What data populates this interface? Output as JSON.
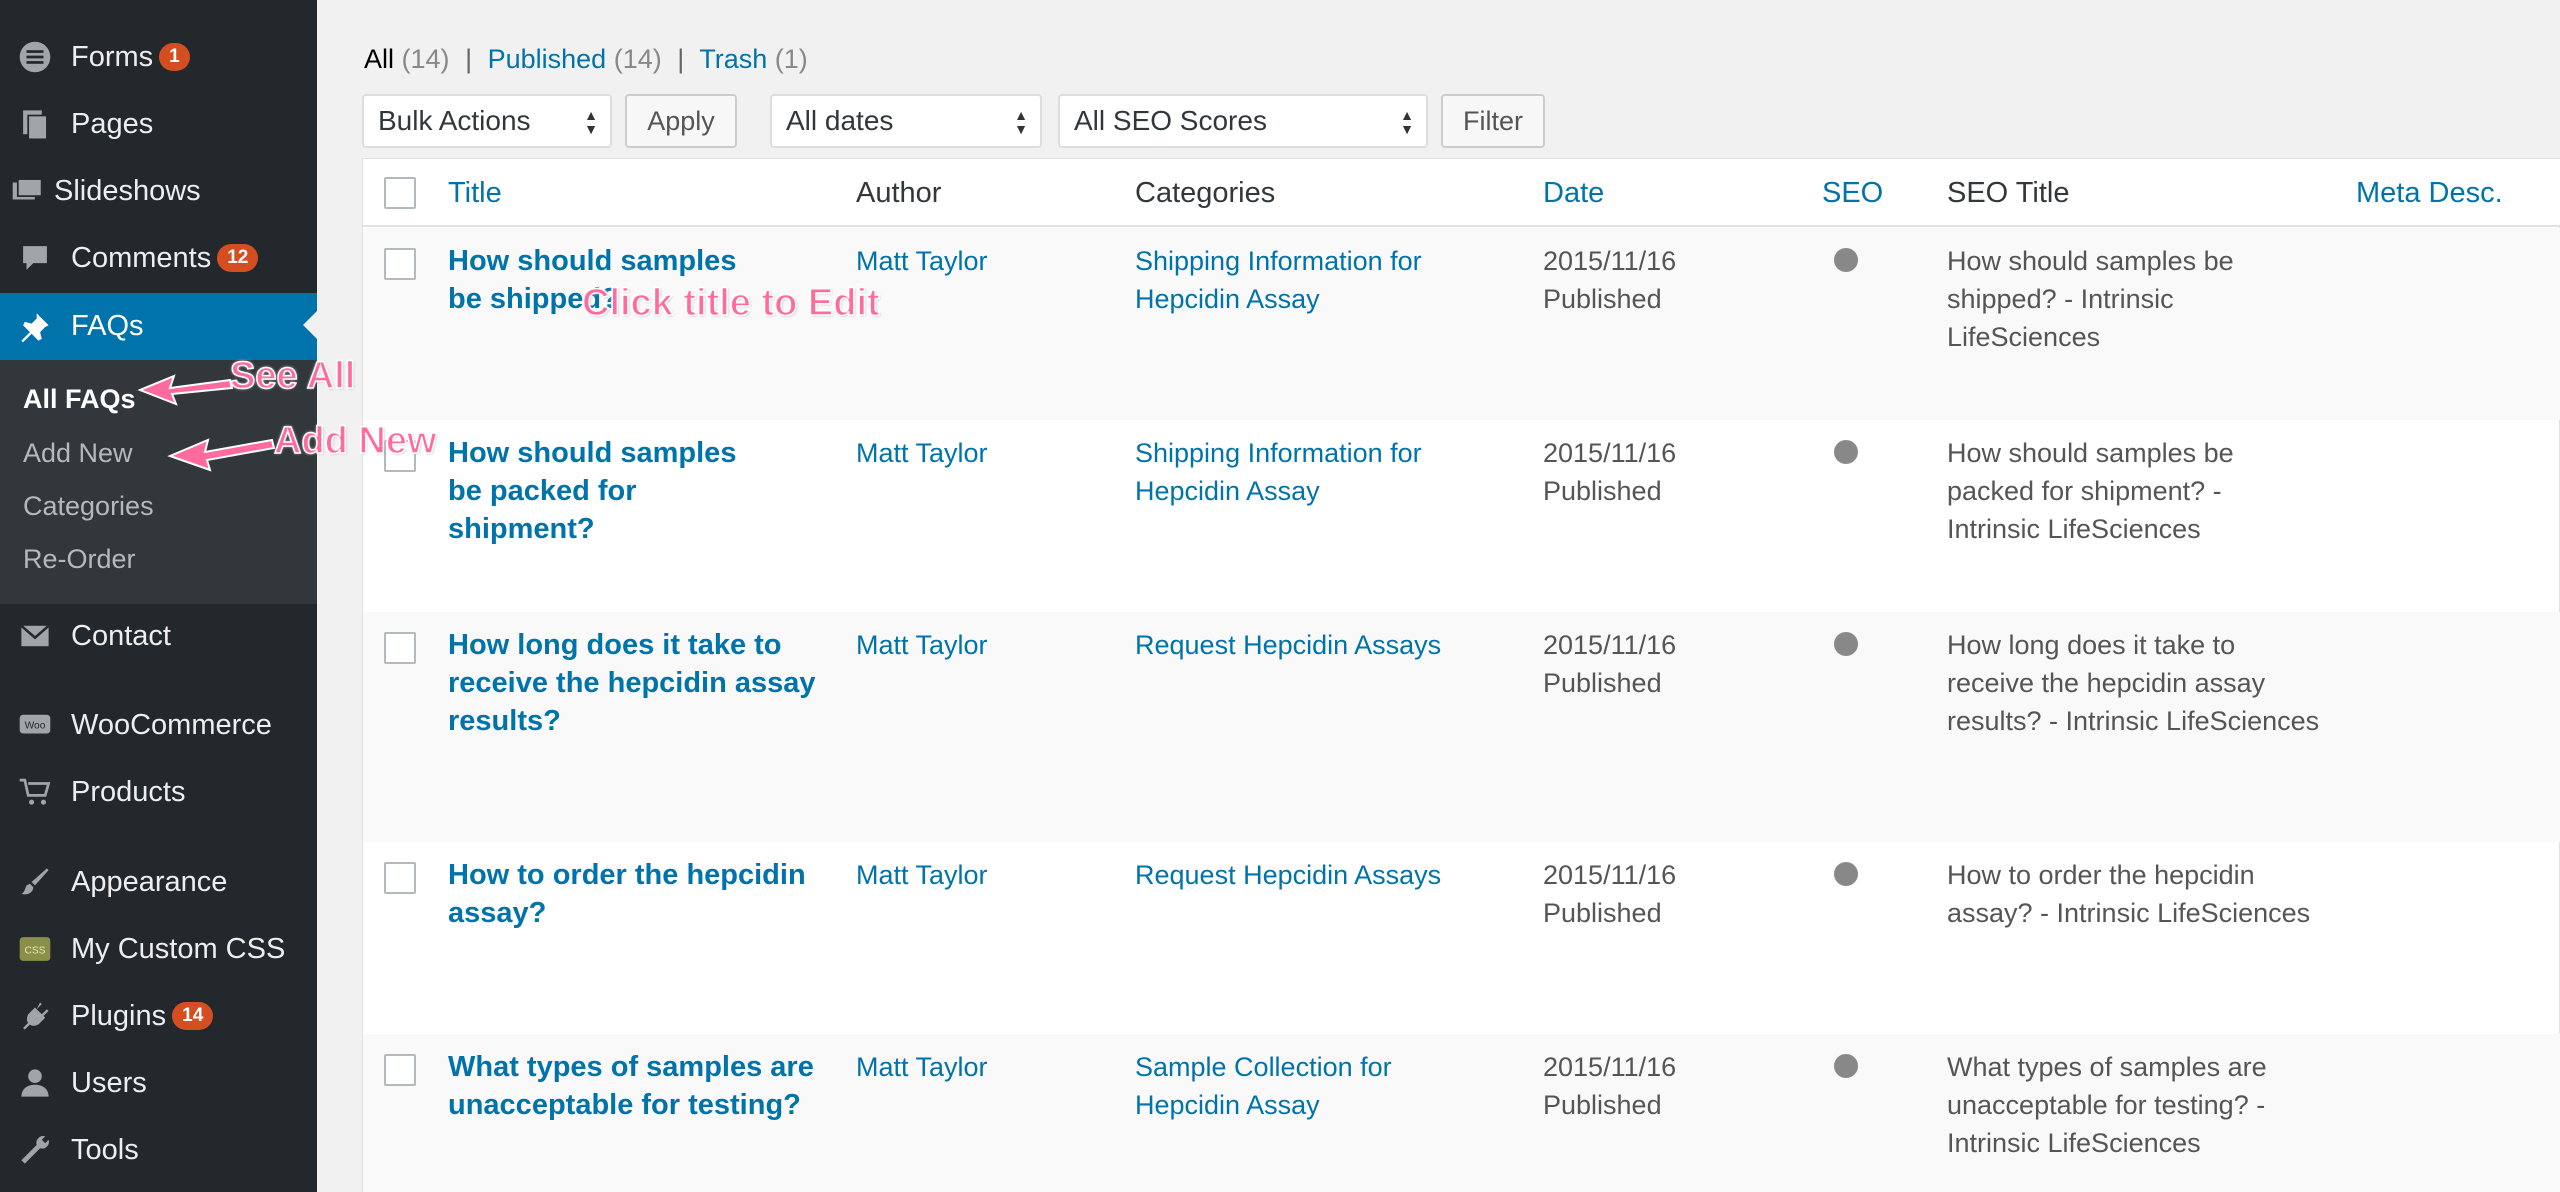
{
  "sidebar": {
    "items": [
      {
        "label": "Forms",
        "badge": "1",
        "icon": "forms-icon"
      },
      {
        "label": "Pages",
        "icon": "pages-icon"
      },
      {
        "label": "Slideshows",
        "icon": "slideshows-icon"
      },
      {
        "label": "Comments",
        "badge": "12",
        "icon": "comments-icon"
      },
      {
        "label": "FAQs",
        "icon": "pin-icon"
      },
      {
        "label": "Contact",
        "icon": "mail-icon"
      },
      {
        "label": "WooCommerce",
        "icon": "woo-icon"
      },
      {
        "label": "Products",
        "icon": "cart-icon"
      },
      {
        "label": "Appearance",
        "icon": "brush-icon"
      },
      {
        "label": "My Custom CSS",
        "icon": "css-icon"
      },
      {
        "label": "Plugins",
        "badge": "14",
        "icon": "plug-icon"
      },
      {
        "label": "Users",
        "icon": "user-icon"
      },
      {
        "label": "Tools",
        "icon": "wrench-icon"
      }
    ],
    "submenu": [
      "All FAQs",
      "Add New",
      "Categories",
      "Re-Order"
    ]
  },
  "filters": {
    "all": "All",
    "all_count": "(14)",
    "published": "Published",
    "published_count": "(14)",
    "trash": "Trash",
    "trash_count": "(1)",
    "sep": "|"
  },
  "toolbar": {
    "bulk_actions": "Bulk Actions",
    "apply": "Apply",
    "dates": "All dates",
    "seo_scores": "All SEO Scores",
    "filter": "Filter"
  },
  "table": {
    "headers": {
      "title": "Title",
      "author": "Author",
      "categories": "Categories",
      "date": "Date",
      "seo": "SEO",
      "seo_title": "SEO Title",
      "meta_desc": "Meta Desc."
    },
    "rows": [
      {
        "title": "How should samples be shipped?",
        "author": "Matt Taylor",
        "category": "Shipping Information for Hepcidin Assay",
        "date": "2015/11/16",
        "status": "Published",
        "seo_title": "How should samples be shipped? - Intrinsic LifeSciences"
      },
      {
        "title": "How should samples be packed for shipment?",
        "author": "Matt Taylor",
        "category": "Shipping Information for Hepcidin Assay",
        "date": "2015/11/16",
        "status": "Published",
        "seo_title": "How should samples be packed for shipment? - Intrinsic LifeSciences"
      },
      {
        "title": "How long does it take to receive the hepcidin assay results?",
        "author": "Matt Taylor",
        "category": "Request Hepcidin Assays",
        "date": "2015/11/16",
        "status": "Published",
        "seo_title": "How long does it take to receive the hepcidin assay results? - Intrinsic LifeSciences"
      },
      {
        "title": "How to order the hepcidin assay?",
        "author": "Matt Taylor",
        "category": "Request Hepcidin Assays",
        "date": "2015/11/16",
        "status": "Published",
        "seo_title": "How to order the hepcidin assay? - Intrinsic LifeSciences"
      },
      {
        "title": "What types of samples are unacceptable for testing?",
        "author": "Matt Taylor",
        "category": "Sample Collection for Hepcidin Assay",
        "date": "2015/11/16",
        "status": "Published",
        "seo_title": "What types of samples are unacceptable for testing? - Intrinsic LifeSciences"
      }
    ]
  },
  "annotations": {
    "edit": "Click title to Edit",
    "see_all": "See All",
    "add_new": "Add New"
  },
  "colors": {
    "accent": "#0073aa",
    "sidebar": "#23282d",
    "badge": "#d54e21",
    "annotation": "#ff6b9d"
  }
}
